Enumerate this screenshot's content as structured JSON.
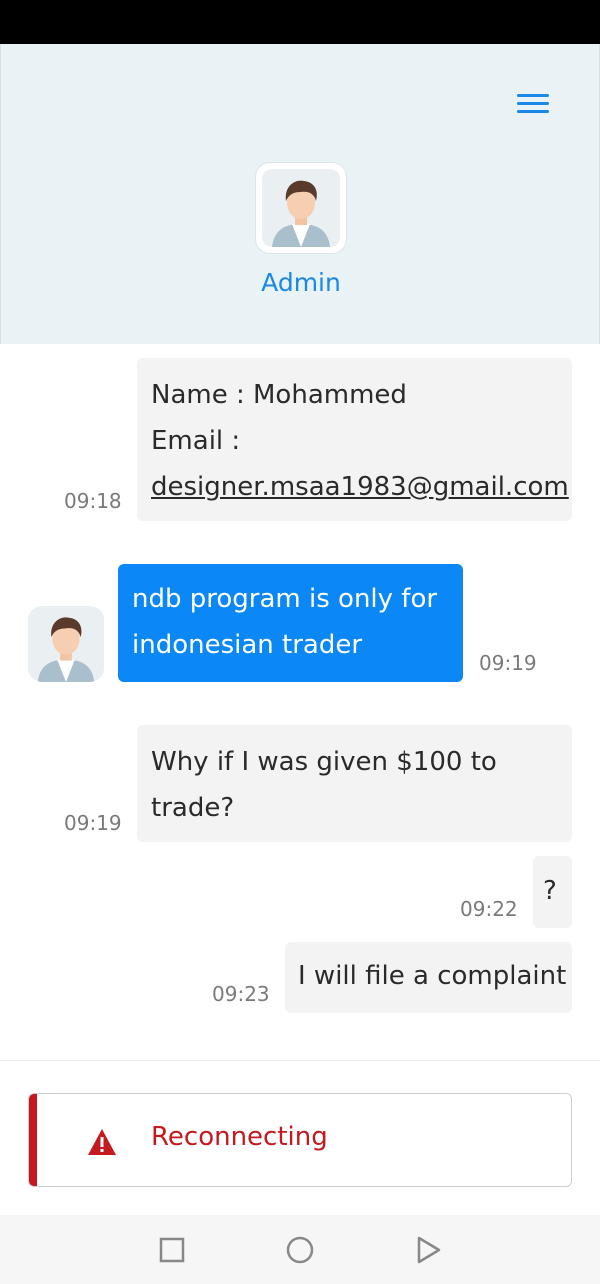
{
  "header": {
    "admin_name": "Admin",
    "menu_icon": "hamburger-menu-icon",
    "accent_color": "#1a88e6"
  },
  "messages": [
    {
      "side": "incoming",
      "line1": "Name : Mohammed",
      "line2": "Email :",
      "email": "designer.msaa1983@gmail.com",
      "time": "09:18"
    },
    {
      "side": "outgoing",
      "line1": "ndb program is only for",
      "line2": "indonesian trader",
      "time": "09:19"
    },
    {
      "side": "incoming",
      "line1": "Why if I was given $100 to",
      "line2": "trade?",
      "time": "09:19"
    },
    {
      "side": "incoming",
      "text": "?",
      "time": "09:22"
    },
    {
      "side": "incoming",
      "text": "I will file a complaint",
      "time": "09:23"
    }
  ],
  "toast": {
    "message": "Reconnecting",
    "icon": "warning-icon",
    "color": "#c4191f"
  },
  "navbar": {
    "recent_icon": "square-icon",
    "home_icon": "circle-icon",
    "back_icon": "triangle-icon"
  }
}
